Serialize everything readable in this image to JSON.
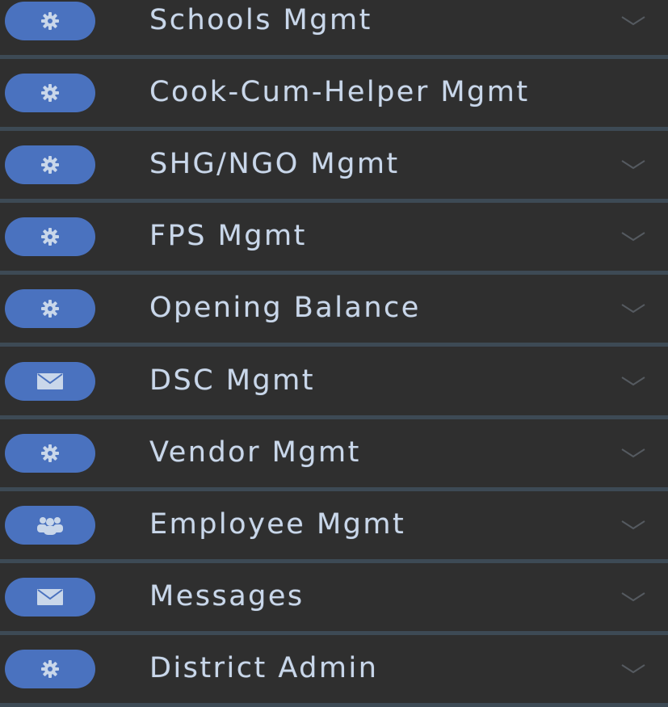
{
  "menu": {
    "items": [
      {
        "label": "Schools Mgmt",
        "icon": "gear-icon",
        "chevron": true
      },
      {
        "label": "Cook-Cum-Helper Mgmt",
        "icon": "gear-icon",
        "chevron": false
      },
      {
        "label": "SHG/NGO Mgmt",
        "icon": "gear-icon",
        "chevron": true
      },
      {
        "label": "FPS Mgmt",
        "icon": "gear-icon",
        "chevron": true
      },
      {
        "label": "Opening Balance",
        "icon": "gear-icon",
        "chevron": true
      },
      {
        "label": "DSC Mgmt",
        "icon": "envelope-icon",
        "chevron": true
      },
      {
        "label": "Vendor Mgmt",
        "icon": "gear-icon",
        "chevron": true
      },
      {
        "label": "Employee Mgmt",
        "icon": "users-icon",
        "chevron": true
      },
      {
        "label": "Messages",
        "icon": "envelope-icon",
        "chevron": true
      },
      {
        "label": "District Admin",
        "icon": "gear-icon",
        "chevron": true
      }
    ]
  },
  "colors": {
    "background": "#2b2b2b",
    "item_background": "#2f2f2f",
    "divider": "#3d4a55",
    "icon_pill": "#4a72bf",
    "text": "#c9d7ea",
    "chevron": "#555a60"
  }
}
